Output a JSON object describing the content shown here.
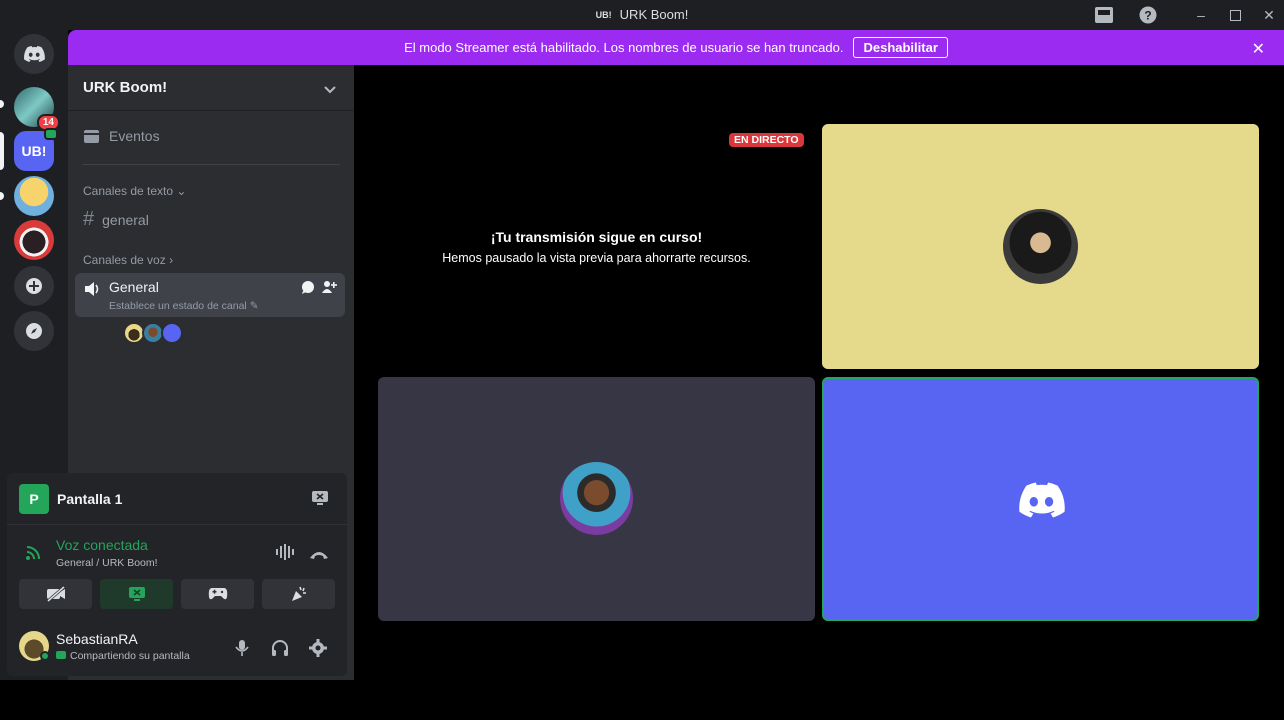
{
  "window": {
    "title": "URK Boom!",
    "title_prefix": "UB!"
  },
  "banner": {
    "message": "El modo Streamer está habilitado. Los nombres de usuario se han truncado.",
    "disable_label": "Deshabilitar"
  },
  "rail": {
    "badge_count": "14",
    "selected_server": "UB!"
  },
  "server": {
    "name": "URK Boom!",
    "events_label": "Eventos",
    "text_category": "Canales de texto",
    "text_channel": "general",
    "voice_category": "Canales de voz",
    "voice_channel": "General",
    "voice_status_placeholder": "Establece un estado de canal"
  },
  "panel": {
    "screen_label": "Pantalla 1",
    "screen_icon_letter": "P",
    "voice_status": "Voz conectada",
    "voice_location": "General / URK Boom!",
    "username": "SebastianRA",
    "user_status": "Compartiendo su pantalla"
  },
  "stage": {
    "live_badge": "EN DIRECTO",
    "paused_title": "¡Tu transmisión sigue en curso!",
    "paused_subtitle": "Hemos pausado la vista previa para ahorrarte recursos."
  },
  "colors": {
    "banner": "#9b2bf0",
    "green": "#23a55a",
    "blurple": "#5865f2",
    "yellow_tile": "#e5d98b",
    "gray_tile": "#373644",
    "live_red": "#da373c"
  }
}
